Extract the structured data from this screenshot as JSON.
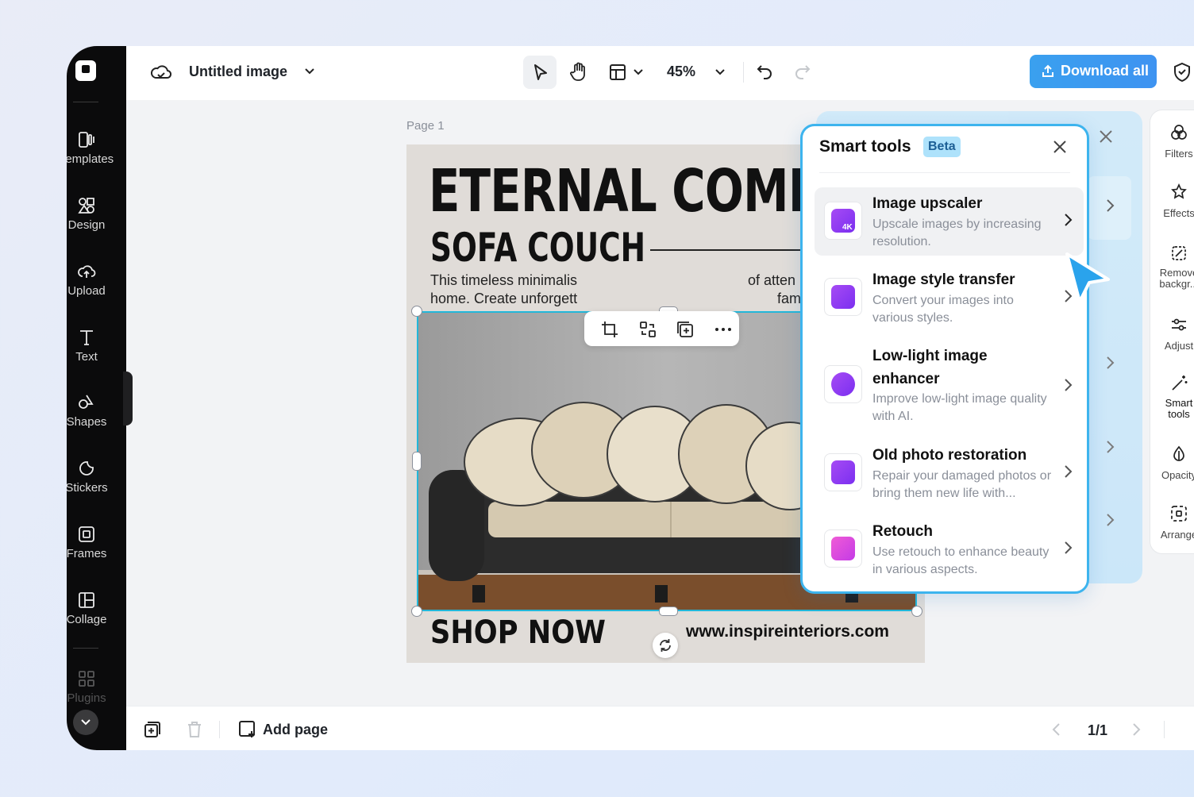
{
  "app": {
    "title": "Untitled image",
    "zoom": "45%",
    "download_label": "Download all",
    "accent_color": "#3aa0ef"
  },
  "rail": {
    "items": [
      {
        "label": "Templates",
        "icon": "templates-icon"
      },
      {
        "label": "Design",
        "icon": "design-icon"
      },
      {
        "label": "Upload",
        "icon": "upload-icon"
      },
      {
        "label": "Text",
        "icon": "text-icon"
      },
      {
        "label": "Shapes",
        "icon": "shapes-icon"
      },
      {
        "label": "Stickers",
        "icon": "stickers-icon"
      },
      {
        "label": "Frames",
        "icon": "frames-icon"
      },
      {
        "label": "Collage",
        "icon": "collage-icon"
      },
      {
        "label": "Plugins",
        "icon": "plugins-icon"
      }
    ]
  },
  "canvas": {
    "page_label": "Page 1",
    "poster": {
      "headline": "ETERNAL COMF",
      "subheadline": "SOFA COUCH",
      "description_line1": "This timeless minimalis",
      "description_line1_tail": "of atten",
      "description_line2": "home. Create unforgett",
      "description_line2_tail": "family i",
      "cta": "SHOP NOW",
      "url": "www.inspireinteriors.com"
    }
  },
  "bottom": {
    "add_page_label": "Add page",
    "pager": "1/1"
  },
  "smart_tools": {
    "title": "Smart tools",
    "badge": "Beta",
    "tools": [
      {
        "name": "Image upscaler",
        "desc": "Upscale images by increasing resolution.",
        "icon": "upscaler-4k-icon"
      },
      {
        "name": "Image style transfer",
        "desc": "Convert your images into various styles.",
        "icon": "style-transfer-icon"
      },
      {
        "name": "Low-light image enhancer",
        "desc": "Improve low-light image quality with AI.",
        "icon": "moon-sparkle-icon"
      },
      {
        "name": "Old photo restoration",
        "desc": "Repair your damaged photos or bring them new life with...",
        "icon": "photo-restore-icon"
      },
      {
        "name": "Retouch",
        "desc": "Use retouch to enhance beauty in various aspects.",
        "icon": "retouch-icon"
      }
    ]
  },
  "right_sidebar": {
    "items": [
      {
        "label": "Filters"
      },
      {
        "label": "Effects"
      },
      {
        "label": "Remove backgr..."
      },
      {
        "label": "Adjust"
      },
      {
        "label": "Smart tools"
      },
      {
        "label": "Opacity"
      },
      {
        "label": "Arrange"
      }
    ]
  }
}
